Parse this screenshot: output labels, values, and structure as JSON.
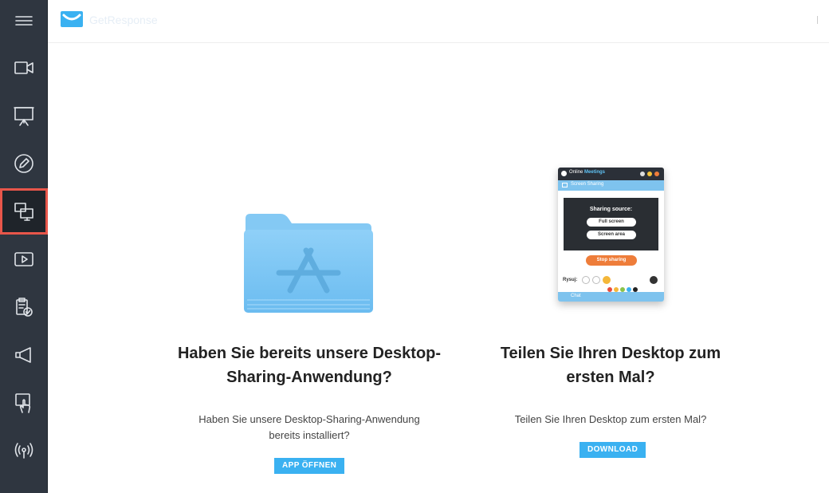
{
  "header": {
    "brand": "GetResponse"
  },
  "sidebar": {
    "items": [
      {
        "icon": "video-camera-icon"
      },
      {
        "icon": "presentation-board-icon"
      },
      {
        "icon": "pencil-icon"
      },
      {
        "icon": "screen-share-icon",
        "active": true
      },
      {
        "icon": "play-video-icon"
      },
      {
        "icon": "clipboard-check-icon"
      },
      {
        "icon": "megaphone-icon"
      },
      {
        "icon": "touch-hand-icon"
      },
      {
        "icon": "broadcast-icon"
      }
    ]
  },
  "left": {
    "headline": "Haben Sie bereits unsere Desktop-Sharing-Anwendung?",
    "description": "Haben Sie unsere Desktop-Sharing-Anwendung bereits installiert?",
    "button": "APP ÖFFNEN"
  },
  "right": {
    "headline": "Teilen Sie Ihren Desktop zum ersten Mal?",
    "description": "Teilen Sie Ihren Desktop zum ersten Mal?",
    "button": "DOWNLOAD"
  },
  "preview": {
    "app_title_prefix": "Online",
    "app_title_suffix": "Meetings",
    "section": "Screen Sharing",
    "sharing_source": "Sharing source:",
    "full_screen": "Full screen",
    "screen_area": "Screen area",
    "stop": "Stop sharing",
    "draw_label": "Rysuj:",
    "chat": "Chat"
  },
  "colors": {
    "accent": "#3ab1f1",
    "sidebar_bg": "#2f3640",
    "active_outline": "#e8564a",
    "stop_orange": "#ee7d3a"
  }
}
